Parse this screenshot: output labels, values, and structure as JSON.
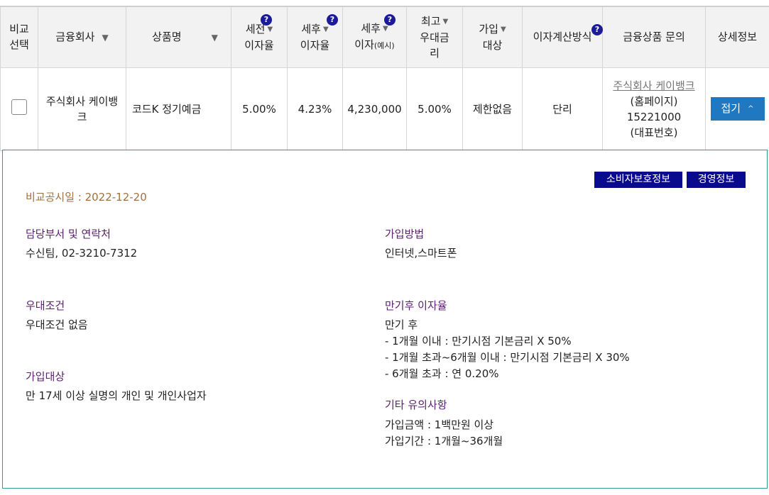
{
  "header": {
    "compare_select": [
      "비교",
      "선택"
    ],
    "company": "금융회사",
    "product": "상품명",
    "pretax": [
      "세전",
      "이자율"
    ],
    "posttax": [
      "세후",
      "이자율"
    ],
    "posttax_interest": [
      "세후",
      "이자",
      "(예시)"
    ],
    "max_rate": [
      "최고",
      "우대금",
      "리"
    ],
    "join_target": [
      "가입",
      "대상"
    ],
    "interest_calc": "이자계산방식",
    "inquiry": "금융상품 문의",
    "detail": "상세정보",
    "help_mark": "?",
    "sort_arrow": "▼"
  },
  "row": {
    "company": "주식회사 케이뱅크",
    "product": "코드K 정기예금",
    "pretax_rate": "5.00%",
    "posttax_rate": "4.23%",
    "posttax_interest": "4,230,000",
    "max_rate": "5.00%",
    "join_target": "제한없음",
    "interest_calc": "단리",
    "inquiry_company": "주식회사 케이뱅크",
    "inquiry_line2": "(홈페이지)",
    "inquiry_phone": "15221000",
    "inquiry_line4": "(대표번호)",
    "fold_label": "접기",
    "fold_icon": "^"
  },
  "detail": {
    "consumer_btn": "소비자보호정보",
    "mgmt_btn": "경영정보",
    "disclosure_date": "비교공시일 : 2022-12-20",
    "dept_h": "담당부서 및 연락처",
    "dept_t": "수신팀, 02-3210-7312",
    "join_method_h": "가입방법",
    "join_method_t": "인터넷,스마트폰",
    "pref_h": "우대조건",
    "pref_t": "우대조건 없음",
    "after_h": "만기후 이자율",
    "after_lines": [
      "만기 후",
      "- 1개월 이내 : 만기시점 기본금리 X 50%",
      "- 1개월 초과~6개월 이내 : 만기시점 기본금리 X 30%",
      "- 6개월 초과 : 연 0.20%"
    ],
    "target_h": "가입대상",
    "target_t": "만 17세 이상 실명의 개인 및 개인사업자",
    "etc_h": "기타 유의사항",
    "etc_lines": [
      "가입금액 : 1백만원 이상",
      "가입기간 : 1개월~36개월"
    ]
  },
  "colors": {
    "header_bg": "#f2f2f2",
    "button_blue": "#1f78c0",
    "tag_navy": "#0a0a8c",
    "heading_purple": "#5a1f6e",
    "date_brown": "#a0703c",
    "panel_border": "#2a9d8f"
  }
}
